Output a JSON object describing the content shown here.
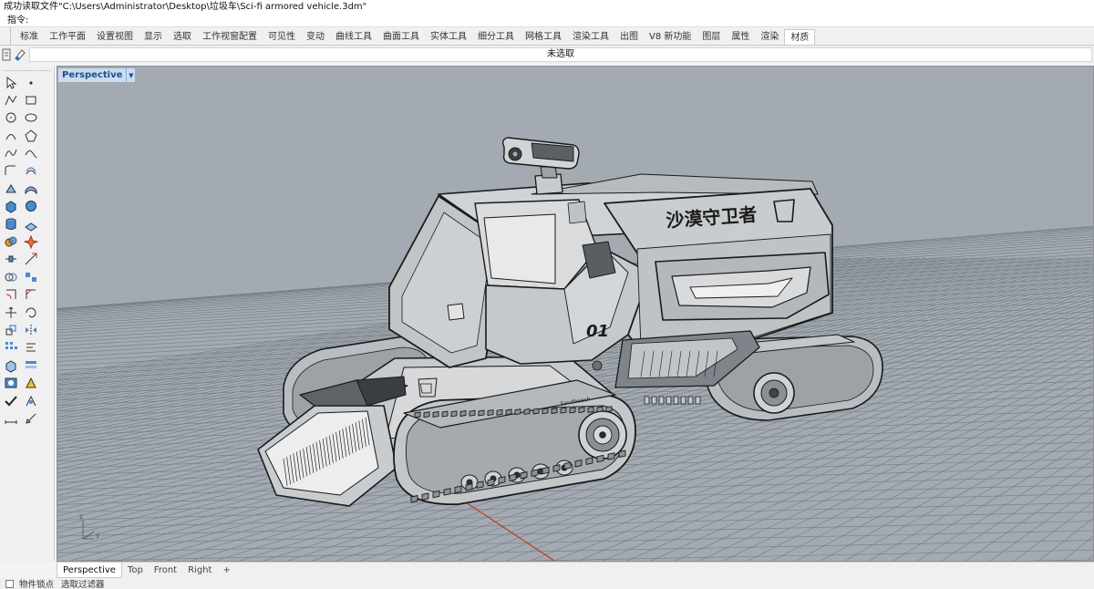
{
  "command": {
    "history": "成功读取文件\"C:\\Users\\Administrator\\Desktop\\垃圾车\\Sci-fi armored vehicle.3dm\"",
    "prompt": "指令:"
  },
  "toolbar_tabs": [
    "标准",
    "工作平面",
    "设置视图",
    "显示",
    "选取",
    "工作视窗配置",
    "可见性",
    "变动",
    "曲线工具",
    "曲面工具",
    "实体工具",
    "细分工具",
    "网格工具",
    "渲染工具",
    "出图",
    "V8 新功能",
    "图层",
    "属性",
    "渲染",
    "材质"
  ],
  "active_tab": "材质",
  "selection_status": "未选取",
  "viewport": {
    "title": "Perspective",
    "decal_text": "沙漠守卫者",
    "vehicle_number": "01",
    "track_brand": "Sandbeach",
    "axis_labels": {
      "y": "y",
      "z": "z"
    }
  },
  "viewport_tabs": [
    "Perspective",
    "Top",
    "Front",
    "Right",
    "+"
  ],
  "active_viewport_tab": "Perspective",
  "status": {
    "osnap": "物件锁点",
    "filter": "选取过滤器"
  },
  "colors": {
    "viewport_bg": "#a3aab1",
    "viewport_title_bg": "#ccdcef",
    "viewport_title_text": "#1a4f93",
    "grid": "#6f7780",
    "body_fill": "#cdd0d3",
    "edge": "#1a1a1a"
  },
  "sidebar_tools": [
    "select-arrow-icon",
    "point-icon",
    "polyline-icon",
    "rectangle-icon",
    "circle-icon",
    "ellipse-icon",
    "arc-icon",
    "polygon-icon",
    "curve-icon",
    "free-curve-icon",
    "fillet-curve-icon",
    "offset-curve-icon",
    "surface-corner-icon",
    "loft-icon",
    "box-solid-icon",
    "sphere-icon",
    "cylinder-icon",
    "mesh-plane-icon",
    "boolean-icon",
    "explode-icon",
    "join-icon",
    "trim-icon",
    "intersect-icon",
    "group-icon",
    "fillet-edge-icon",
    "chamfer-icon",
    "move-icon",
    "rotate-icon",
    "scale-icon",
    "mirror-icon",
    "array-icon",
    "align-icon",
    "block-icon",
    "layer-icon",
    "render-icon",
    "material-icon",
    "check-icon",
    "analyze-icon",
    "dimension-icon",
    "annotation-icon"
  ]
}
